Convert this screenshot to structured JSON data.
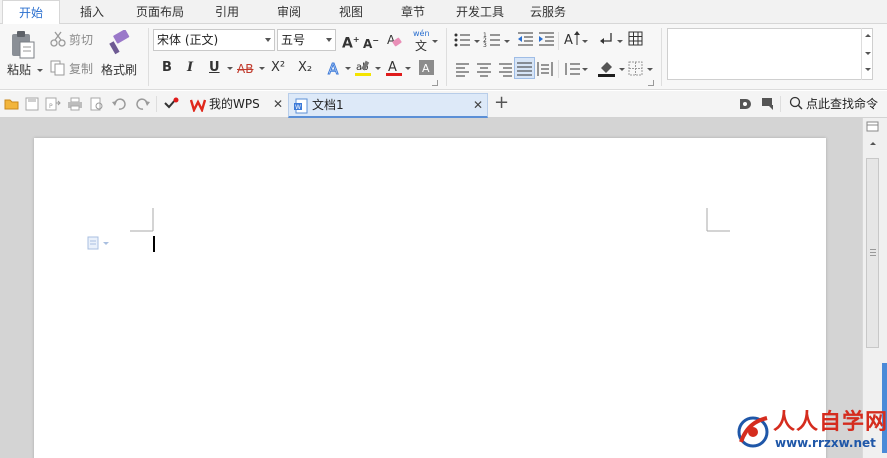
{
  "menu": {
    "tabs": [
      {
        "label": "开始",
        "active": true
      },
      {
        "label": "插入"
      },
      {
        "label": "页面布局"
      },
      {
        "label": "引用"
      },
      {
        "label": "审阅"
      },
      {
        "label": "视图"
      },
      {
        "label": "章节"
      },
      {
        "label": "开发工具"
      },
      {
        "label": "云服务"
      }
    ]
  },
  "ribbon": {
    "clipboard": {
      "paste": "粘贴",
      "cut": "剪切",
      "copy": "复制",
      "format_painter": "格式刷"
    },
    "font": {
      "font_name": "宋体 (正文)",
      "font_size": "五号",
      "bold": "B",
      "italic": "I",
      "underline": "U",
      "strike": "AB",
      "superscript": "X²",
      "subscript": "X₂",
      "phonetic": "wén"
    }
  },
  "quickbar": {
    "tabs": [
      {
        "label": "我的WPS"
      },
      {
        "label": "文档1",
        "active": true
      }
    ],
    "search_label": "点此查找命令"
  },
  "watermark": {
    "title": "人人自学网",
    "url": "www.rrzxw.net"
  },
  "colors": {
    "accent": "#2a6fcf",
    "active_tab_bg": "#dde9f8",
    "watermark_red": "#d52c1e",
    "watermark_blue": "#1f57a8"
  }
}
